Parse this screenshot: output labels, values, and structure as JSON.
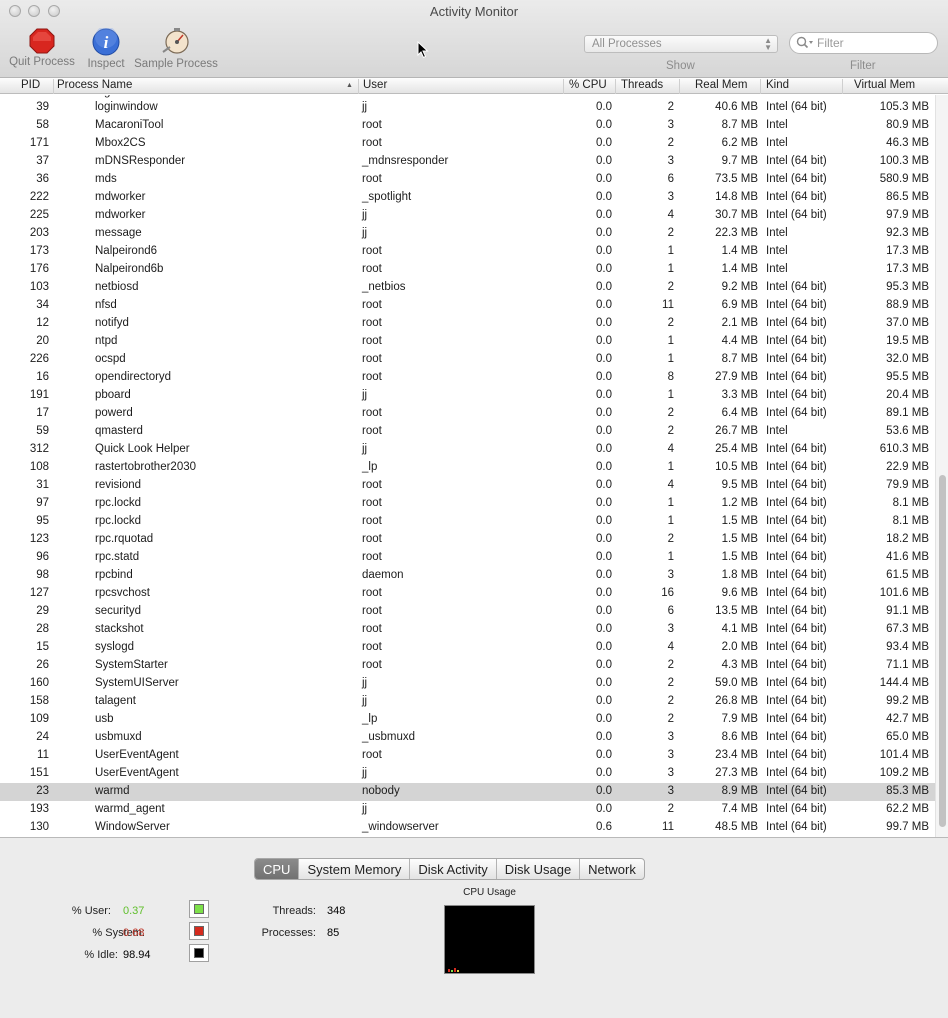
{
  "window": {
    "title": "Activity Monitor"
  },
  "toolbar": {
    "quit_label": "Quit Process",
    "inspect_label": "Inspect",
    "sample_label": "Sample Process",
    "show_value": "All Processes",
    "show_label": "Show",
    "filter_placeholder": "Filter",
    "filter_label": "Filter"
  },
  "table": {
    "headers": [
      "PID",
      "Process Name",
      "User",
      "% CPU",
      "Threads",
      "Real Mem",
      "Kind",
      "Virtual Mem"
    ],
    "partial_row_name": "loginwi",
    "rows": [
      [
        "39",
        "loginwindow",
        "jj",
        "0.0",
        "2",
        "40.6 MB",
        "Intel (64 bit)",
        "105.3 MB"
      ],
      [
        "58",
        "MacaroniTool",
        "root",
        "0.0",
        "3",
        "8.7 MB",
        "Intel",
        "80.9 MB"
      ],
      [
        "171",
        "Mbox2CS",
        "root",
        "0.0",
        "2",
        "6.2 MB",
        "Intel",
        "46.3 MB"
      ],
      [
        "37",
        "mDNSResponder",
        "_mdnsresponder",
        "0.0",
        "3",
        "9.7 MB",
        "Intel (64 bit)",
        "100.3 MB"
      ],
      [
        "36",
        "mds",
        "root",
        "0.0",
        "6",
        "73.5 MB",
        "Intel (64 bit)",
        "580.9 MB"
      ],
      [
        "222",
        "mdworker",
        "_spotlight",
        "0.0",
        "3",
        "14.8 MB",
        "Intel (64 bit)",
        "86.5 MB"
      ],
      [
        "225",
        "mdworker",
        "jj",
        "0.0",
        "4",
        "30.7 MB",
        "Intel (64 bit)",
        "97.9 MB"
      ],
      [
        "203",
        "message",
        "jj",
        "0.0",
        "2",
        "22.3 MB",
        "Intel",
        "92.3 MB"
      ],
      [
        "173",
        "Nalpeirond6",
        "root",
        "0.0",
        "1",
        "1.4 MB",
        "Intel",
        "17.3 MB"
      ],
      [
        "176",
        "Nalpeirond6b",
        "root",
        "0.0",
        "1",
        "1.4 MB",
        "Intel",
        "17.3 MB"
      ],
      [
        "103",
        "netbiosd",
        "_netbios",
        "0.0",
        "2",
        "9.2 MB",
        "Intel (64 bit)",
        "95.3 MB"
      ],
      [
        "34",
        "nfsd",
        "root",
        "0.0",
        "11",
        "6.9 MB",
        "Intel (64 bit)",
        "88.9 MB"
      ],
      [
        "12",
        "notifyd",
        "root",
        "0.0",
        "2",
        "2.1 MB",
        "Intel (64 bit)",
        "37.0 MB"
      ],
      [
        "20",
        "ntpd",
        "root",
        "0.0",
        "1",
        "4.4 MB",
        "Intel (64 bit)",
        "19.5 MB"
      ],
      [
        "226",
        "ocspd",
        "root",
        "0.0",
        "1",
        "8.7 MB",
        "Intel (64 bit)",
        "32.0 MB"
      ],
      [
        "16",
        "opendirectoryd",
        "root",
        "0.0",
        "8",
        "27.9 MB",
        "Intel (64 bit)",
        "95.5 MB"
      ],
      [
        "191",
        "pboard",
        "jj",
        "0.0",
        "1",
        "3.3 MB",
        "Intel (64 bit)",
        "20.4 MB"
      ],
      [
        "17",
        "powerd",
        "root",
        "0.0",
        "2",
        "6.4 MB",
        "Intel (64 bit)",
        "89.1 MB"
      ],
      [
        "59",
        "qmasterd",
        "root",
        "0.0",
        "2",
        "26.7 MB",
        "Intel",
        "53.6 MB"
      ],
      [
        "312",
        "Quick Look Helper",
        "jj",
        "0.0",
        "4",
        "25.4 MB",
        "Intel (64 bit)",
        "610.3 MB"
      ],
      [
        "108",
        "rastertobrother2030",
        "_lp",
        "0.0",
        "1",
        "10.5 MB",
        "Intel (64 bit)",
        "22.9 MB"
      ],
      [
        "31",
        "revisiond",
        "root",
        "0.0",
        "4",
        "9.5 MB",
        "Intel (64 bit)",
        "79.9 MB"
      ],
      [
        "97",
        "rpc.lockd",
        "root",
        "0.0",
        "1",
        "1.2 MB",
        "Intel (64 bit)",
        "8.1 MB"
      ],
      [
        "95",
        "rpc.lockd",
        "root",
        "0.0",
        "1",
        "1.5 MB",
        "Intel (64 bit)",
        "8.1 MB"
      ],
      [
        "123",
        "rpc.rquotad",
        "root",
        "0.0",
        "2",
        "1.5 MB",
        "Intel (64 bit)",
        "18.2 MB"
      ],
      [
        "96",
        "rpc.statd",
        "root",
        "0.0",
        "1",
        "1.5 MB",
        "Intel (64 bit)",
        "41.6 MB"
      ],
      [
        "98",
        "rpcbind",
        "daemon",
        "0.0",
        "3",
        "1.8 MB",
        "Intel (64 bit)",
        "61.5 MB"
      ],
      [
        "127",
        "rpcsvchost",
        "root",
        "0.0",
        "16",
        "9.6 MB",
        "Intel (64 bit)",
        "101.6 MB"
      ],
      [
        "29",
        "securityd",
        "root",
        "0.0",
        "6",
        "13.5 MB",
        "Intel (64 bit)",
        "91.1 MB"
      ],
      [
        "28",
        "stackshot",
        "root",
        "0.0",
        "3",
        "4.1 MB",
        "Intel (64 bit)",
        "67.3 MB"
      ],
      [
        "15",
        "syslogd",
        "root",
        "0.0",
        "4",
        "2.0 MB",
        "Intel (64 bit)",
        "93.4 MB"
      ],
      [
        "26",
        "SystemStarter",
        "root",
        "0.0",
        "2",
        "4.3 MB",
        "Intel (64 bit)",
        "71.1 MB"
      ],
      [
        "160",
        "SystemUIServer",
        "jj",
        "0.0",
        "2",
        "59.0 MB",
        "Intel (64 bit)",
        "144.4 MB"
      ],
      [
        "158",
        "talagent",
        "jj",
        "0.0",
        "2",
        "26.8 MB",
        "Intel (64 bit)",
        "99.2 MB"
      ],
      [
        "109",
        "usb",
        "_lp",
        "0.0",
        "2",
        "7.9 MB",
        "Intel (64 bit)",
        "42.7 MB"
      ],
      [
        "24",
        "usbmuxd",
        "_usbmuxd",
        "0.0",
        "3",
        "8.6 MB",
        "Intel (64 bit)",
        "65.0 MB"
      ],
      [
        "11",
        "UserEventAgent",
        "root",
        "0.0",
        "3",
        "23.4 MB",
        "Intel (64 bit)",
        "101.4 MB"
      ],
      [
        "151",
        "UserEventAgent",
        "jj",
        "0.0",
        "3",
        "27.3 MB",
        "Intel (64 bit)",
        "109.2 MB"
      ],
      [
        "23",
        "warmd",
        "nobody",
        "0.0",
        "3",
        "8.9 MB",
        "Intel (64 bit)",
        "85.3 MB"
      ],
      [
        "193",
        "warmd_agent",
        "jj",
        "0.0",
        "2",
        "7.4 MB",
        "Intel (64 bit)",
        "62.2 MB"
      ],
      [
        "130",
        "WindowServer",
        "_windowserver",
        "0.6",
        "11",
        "48.5 MB",
        "Intel (64 bit)",
        "99.7 MB"
      ]
    ],
    "selected_row_index": 38
  },
  "tabs": [
    "CPU",
    "System Memory",
    "Disk Activity",
    "Disk Usage",
    "Network"
  ],
  "active_tab": 0,
  "stats": {
    "user_label": "% User:",
    "user_value": "0.37",
    "system_label": "% System:",
    "system_value": "0.68",
    "idle_label": "% Idle:",
    "idle_value": "98.94",
    "threads_label": "Threads:",
    "threads_value": "348",
    "processes_label": "Processes:",
    "processes_value": "85"
  },
  "cpu_usage": {
    "title": "CPU Usage"
  },
  "colors": {
    "user": "#5fbf2a",
    "system": "#c0392b",
    "idle": "#000000",
    "user_swatch": "#7ee04a",
    "system_swatch": "#d52b1e"
  }
}
